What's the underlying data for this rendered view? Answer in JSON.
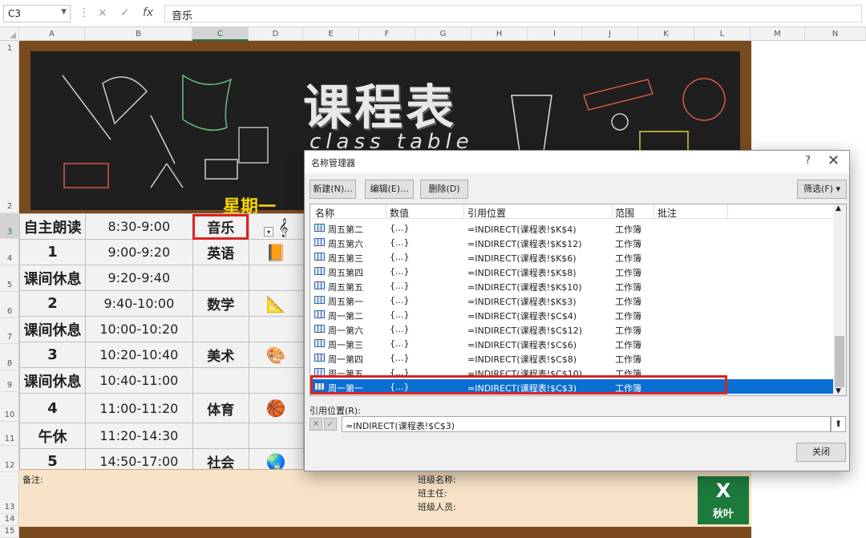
{
  "formula_bar": {
    "cell_ref": "C3",
    "formula": "音乐",
    "cancel_icon": "×",
    "enter_icon": "✓",
    "fx": "fx"
  },
  "columns": [
    "A",
    "B",
    "C",
    "D",
    "E",
    "F",
    "G",
    "H",
    "I",
    "J",
    "K",
    "L",
    "M",
    "N"
  ],
  "rows": [
    "1",
    "2",
    "3",
    "4",
    "5",
    "6",
    "7",
    "8",
    "9",
    "10",
    "11",
    "12",
    "13",
    "14",
    "15"
  ],
  "board": {
    "title": "课程表",
    "subtitle": "class table",
    "day": "星期一"
  },
  "schedule": [
    {
      "period": "自主朗读",
      "time": "8:30-9:00",
      "subject": "音乐",
      "icon": "𝄞"
    },
    {
      "period": "1",
      "time": "9:00-9:20",
      "subject": "英语",
      "icon": "📙"
    },
    {
      "period": "课间休息",
      "time": "9:20-9:40",
      "subject": "",
      "icon": ""
    },
    {
      "period": "2",
      "time": "9:40-10:00",
      "subject": "数学",
      "icon": "📐"
    },
    {
      "period": "课间休息",
      "time": "10:00-10:20",
      "subject": "",
      "icon": ""
    },
    {
      "period": "3",
      "time": "10:20-10:40",
      "subject": "美术",
      "icon": "🎨"
    },
    {
      "period": "课间休息",
      "time": "10:40-11:00",
      "subject": "",
      "icon": ""
    },
    {
      "period": "4",
      "time": "11:00-11:20",
      "subject": "体育",
      "icon": "🏀"
    },
    {
      "period": "午休",
      "time": "11:20-14:30",
      "subject": "",
      "icon": ""
    },
    {
      "period": "5",
      "time": "14:50-17:00",
      "subject": "社会",
      "icon": "🌏"
    }
  ],
  "notes": {
    "label": "备注:",
    "class_name": "班级名称:",
    "teacher": "班主任:",
    "members": "班级人员:"
  },
  "logo": {
    "x": "X",
    "text": "秋叶"
  },
  "dialog": {
    "title": "名称管理器",
    "help": "?",
    "close_x": "✕",
    "buttons": {
      "new": "新建(N)...",
      "edit": "编辑(E)...",
      "delete": "删除(D)",
      "filter": "筛选(F) ▾"
    },
    "headers": {
      "name": "名称",
      "value": "数值",
      "ref": "引用位置",
      "scope": "范围",
      "comment": "批注"
    },
    "rows": [
      {
        "name": "周五第二",
        "value": "{...}",
        "ref": "=INDIRECT(课程表!$K$4)",
        "scope": "工作簿"
      },
      {
        "name": "周五第六",
        "value": "{...}",
        "ref": "=INDIRECT(课程表!$K$12)",
        "scope": "工作簿"
      },
      {
        "name": "周五第三",
        "value": "{...}",
        "ref": "=INDIRECT(课程表!$K$6)",
        "scope": "工作簿"
      },
      {
        "name": "周五第四",
        "value": "{...}",
        "ref": "=INDIRECT(课程表!$K$8)",
        "scope": "工作簿"
      },
      {
        "name": "周五第五",
        "value": "{...}",
        "ref": "=INDIRECT(课程表!$K$10)",
        "scope": "工作簿"
      },
      {
        "name": "周五第一",
        "value": "{...}",
        "ref": "=INDIRECT(课程表!$K$3)",
        "scope": "工作簿"
      },
      {
        "name": "周一第二",
        "value": "{...}",
        "ref": "=INDIRECT(课程表!$C$4)",
        "scope": "工作簿"
      },
      {
        "name": "周一第六",
        "value": "{...}",
        "ref": "=INDIRECT(课程表!$C$12)",
        "scope": "工作簿"
      },
      {
        "name": "周一第三",
        "value": "{...}",
        "ref": "=INDIRECT(课程表!$C$6)",
        "scope": "工作簿"
      },
      {
        "name": "周一第四",
        "value": "{...}",
        "ref": "=INDIRECT(课程表!$C$8)",
        "scope": "工作簿"
      },
      {
        "name": "周一第五",
        "value": "{...}",
        "ref": "=INDIRECT(课程表!$C$10)",
        "scope": "工作簿"
      },
      {
        "name": "周一第一",
        "value": "{...}",
        "ref": "=INDIRECT(课程表!$C$3)",
        "scope": "工作簿",
        "selected": true
      }
    ],
    "ref_label": "引用位置(R):",
    "ref_value": "=INDIRECT(课程表!$C$3)",
    "ref_collapse": "⬆",
    "close": "关闭"
  }
}
